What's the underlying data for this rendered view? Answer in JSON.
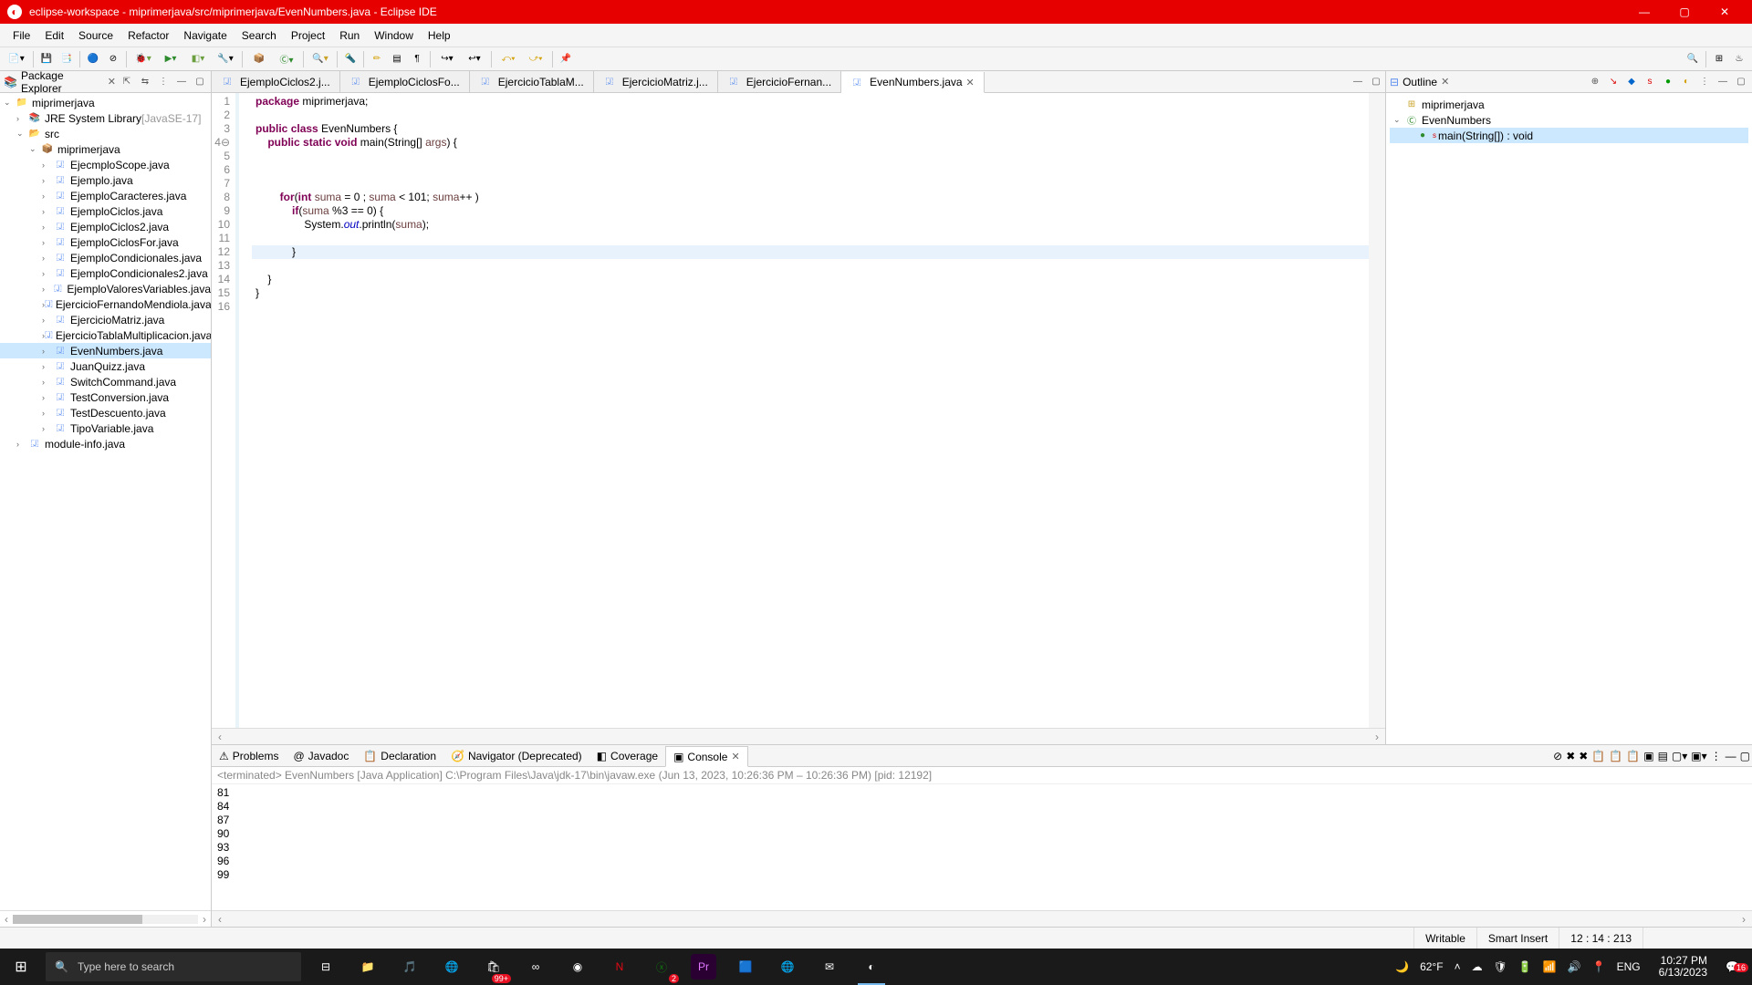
{
  "window": {
    "title": "eclipse-workspace - miprimerjava/src/miprimerjava/EvenNumbers.java - Eclipse IDE"
  },
  "menu": [
    "File",
    "Edit",
    "Source",
    "Refactor",
    "Navigate",
    "Search",
    "Project",
    "Run",
    "Window",
    "Help"
  ],
  "package_explorer": {
    "title": "Package Explorer",
    "project": "miprimerjava",
    "jre": "JRE System Library",
    "jre_ver": "[JavaSE-17]",
    "src": "src",
    "pkg": "miprimerjava",
    "files": [
      "EjecmploScope.java",
      "Ejemplo.java",
      "EjemploCaracteres.java",
      "EjemploCiclos.java",
      "EjemploCiclos2.java",
      "EjemploCiclosFor.java",
      "EjemploCondicionales.java",
      "EjemploCondicionales2.java",
      "EjemploValoresVariables.java",
      "EjercicioFernandoMendiola.java",
      "EjercicioMatriz.java",
      "EjercicioTablaMultiplicacion.java",
      "EvenNumbers.java",
      "JuanQuizz.java",
      "SwitchCommand.java",
      "TestConversion.java",
      "TestDescuento.java",
      "TipoVariable.java"
    ],
    "module": "module-info.java",
    "selected": "EvenNumbers.java"
  },
  "editor_tabs": [
    "EjemploCiclos2.j...",
    "EjemploCiclosFo...",
    "EjercicioTablaM...",
    "EjercicioMatriz.j...",
    "EjercicioFernan...",
    "EvenNumbers.java"
  ],
  "editor_active": 5,
  "code": {
    "lines": [
      {
        "n": "1",
        "tokens": [
          {
            "t": "kw",
            "v": "package"
          },
          {
            "t": "",
            "v": " miprimerjava;"
          }
        ]
      },
      {
        "n": "2",
        "tokens": []
      },
      {
        "n": "3",
        "tokens": [
          {
            "t": "kw",
            "v": "public"
          },
          {
            "t": "",
            "v": " "
          },
          {
            "t": "kw",
            "v": "class"
          },
          {
            "t": "",
            "v": " EvenNumbers {"
          }
        ]
      },
      {
        "n": "4",
        "marker": "⊖",
        "tokens": [
          {
            "t": "",
            "v": "    "
          },
          {
            "t": "kw",
            "v": "public"
          },
          {
            "t": "",
            "v": " "
          },
          {
            "t": "kw",
            "v": "static"
          },
          {
            "t": "",
            "v": " "
          },
          {
            "t": "kw",
            "v": "void"
          },
          {
            "t": "",
            "v": " main(String[] "
          },
          {
            "t": "var",
            "v": "args"
          },
          {
            "t": "",
            "v": ") {"
          }
        ]
      },
      {
        "n": "5",
        "tokens": []
      },
      {
        "n": "6",
        "tokens": []
      },
      {
        "n": "7",
        "tokens": []
      },
      {
        "n": "8",
        "tokens": [
          {
            "t": "",
            "v": "        "
          },
          {
            "t": "kw",
            "v": "for"
          },
          {
            "t": "",
            "v": "("
          },
          {
            "t": "kw",
            "v": "int"
          },
          {
            "t": "",
            "v": " "
          },
          {
            "t": "var",
            "v": "suma"
          },
          {
            "t": "",
            "v": " = 0 ; "
          },
          {
            "t": "var",
            "v": "suma"
          },
          {
            "t": "",
            "v": " < 101; "
          },
          {
            "t": "var",
            "v": "suma"
          },
          {
            "t": "",
            "v": "++ )"
          }
        ]
      },
      {
        "n": "9",
        "tokens": [
          {
            "t": "",
            "v": "            "
          },
          {
            "t": "kw",
            "v": "if"
          },
          {
            "t": "",
            "v": "("
          },
          {
            "t": "var",
            "v": "suma"
          },
          {
            "t": "",
            "v": " %3 == 0) {"
          }
        ]
      },
      {
        "n": "10",
        "tokens": [
          {
            "t": "",
            "v": "                System."
          },
          {
            "t": "fld",
            "v": "out"
          },
          {
            "t": "",
            "v": ".println("
          },
          {
            "t": "var",
            "v": "suma"
          },
          {
            "t": "",
            "v": ");"
          }
        ]
      },
      {
        "n": "11",
        "tokens": []
      },
      {
        "n": "12",
        "hl": true,
        "tokens": [
          {
            "t": "",
            "v": "            }"
          }
        ]
      },
      {
        "n": "13",
        "tokens": []
      },
      {
        "n": "14",
        "tokens": [
          {
            "t": "",
            "v": "    }"
          }
        ]
      },
      {
        "n": "15",
        "tokens": [
          {
            "t": "",
            "v": "}"
          }
        ]
      },
      {
        "n": "16",
        "tokens": []
      }
    ]
  },
  "outline": {
    "title": "Outline",
    "pkg": "miprimerjava",
    "class": "EvenNumbers",
    "method": "main(String[]) : void"
  },
  "bottom_tabs": [
    "Problems",
    "Javadoc",
    "Declaration",
    "Navigator (Deprecated)",
    "Coverage",
    "Console"
  ],
  "bottom_active": 5,
  "console": {
    "header": "<terminated> EvenNumbers [Java Application] C:\\Program Files\\Java\\jdk-17\\bin\\javaw.exe  (Jun 13, 2023, 10:26:36 PM – 10:26:36 PM) [pid: 12192]",
    "lines": [
      "81",
      "84",
      "87",
      "90",
      "93",
      "96",
      "99"
    ]
  },
  "status": {
    "writable": "Writable",
    "insert": "Smart Insert",
    "pos": "12 : 14 : 213"
  },
  "taskbar": {
    "search_placeholder": "Type here to search",
    "weather": "62°F",
    "lang": "ENG",
    "time": "10:27 PM",
    "date": "6/13/2023"
  }
}
